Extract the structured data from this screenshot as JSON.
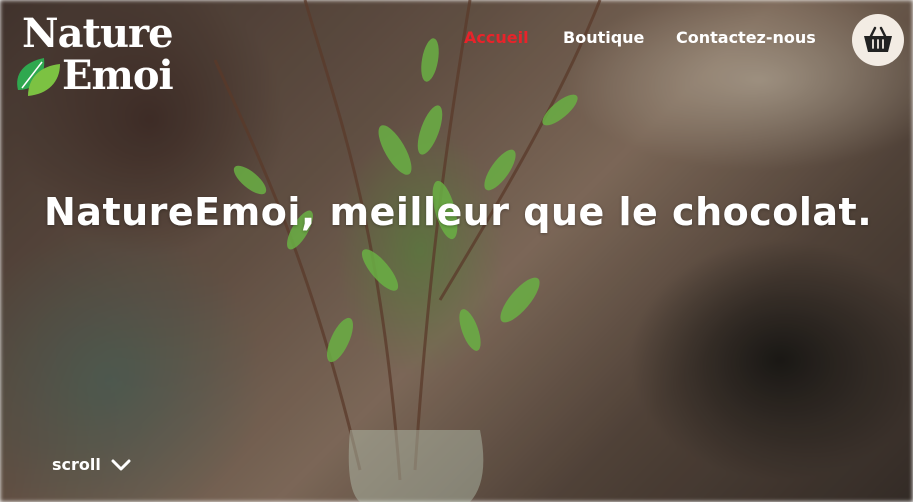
{
  "logo": {
    "line1": "Nature",
    "line2": "Emoi",
    "icon": "leaf-icon"
  },
  "nav": {
    "items": [
      {
        "label": "Accueil",
        "active": true
      },
      {
        "label": "Boutique",
        "active": false
      },
      {
        "label": "Contactez-nous",
        "active": false
      }
    ],
    "active_color": "#e8232a"
  },
  "cart": {
    "icon": "shopping-basket-icon"
  },
  "hero": {
    "title": "NatureEmoi, meilleur que le chocolat."
  },
  "scroll": {
    "label": "scroll",
    "icon": "chevron-down-icon"
  }
}
